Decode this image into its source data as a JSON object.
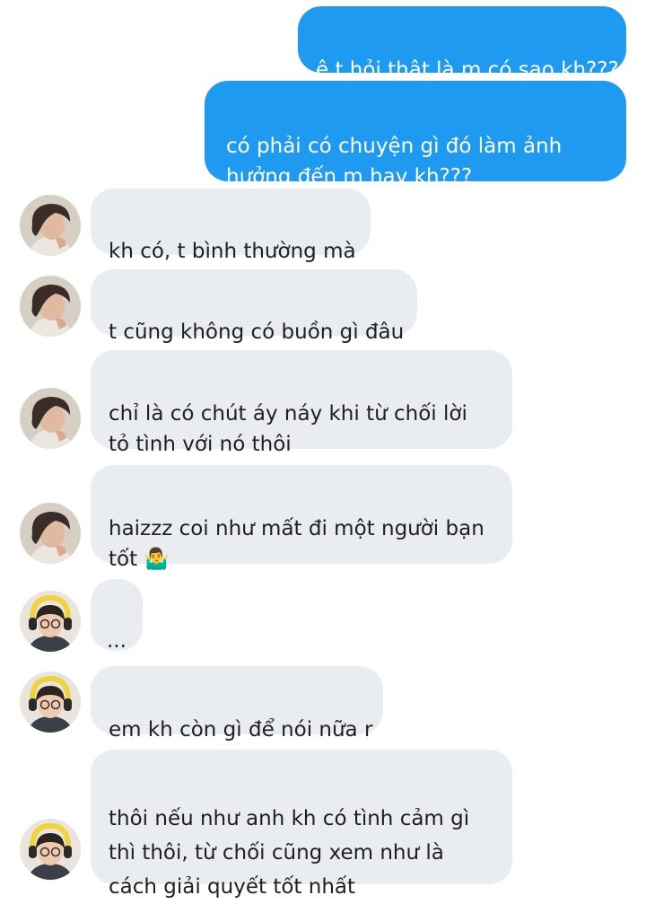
{
  "chat": {
    "messages": [
      {
        "side": "out",
        "text": "ê t hỏi thật là m có sao kh???"
      },
      {
        "side": "out",
        "text": "có phải có chuyện gì đó làm ảnh hưởng đến m hay kh???"
      },
      {
        "side": "in",
        "sender": "guy",
        "text": "kh có, t bình thường mà"
      },
      {
        "side": "in",
        "sender": "guy",
        "text": "t cũng không có buồn gì đâu"
      },
      {
        "side": "in",
        "sender": "guy",
        "text": "chỉ là có chút áy náy khi từ chối lời tỏ tình với nó thôi"
      },
      {
        "side": "in",
        "sender": "guy",
        "text": "haizzz coi như mất đi một người bạn tốt 🤷‍♂️"
      },
      {
        "side": "in",
        "sender": "girl",
        "text": "..."
      },
      {
        "side": "in",
        "sender": "girl",
        "text": "em kh còn gì để nói nữa r"
      },
      {
        "side": "in",
        "sender": "girl",
        "text": "thôi nếu như anh kh có tình cảm gì thì thôi, từ chối cũng xem như là cách giải quyết tốt nhất"
      }
    ]
  },
  "avatars": {
    "guy": "avatar-guy",
    "girl": "avatar-girl-headphones"
  },
  "colors": {
    "outgoing_bubble": "#1e9bf0",
    "incoming_bubble": "#e9edf2",
    "outgoing_text": "#ffffff",
    "incoming_text": "#1f1f1f"
  }
}
